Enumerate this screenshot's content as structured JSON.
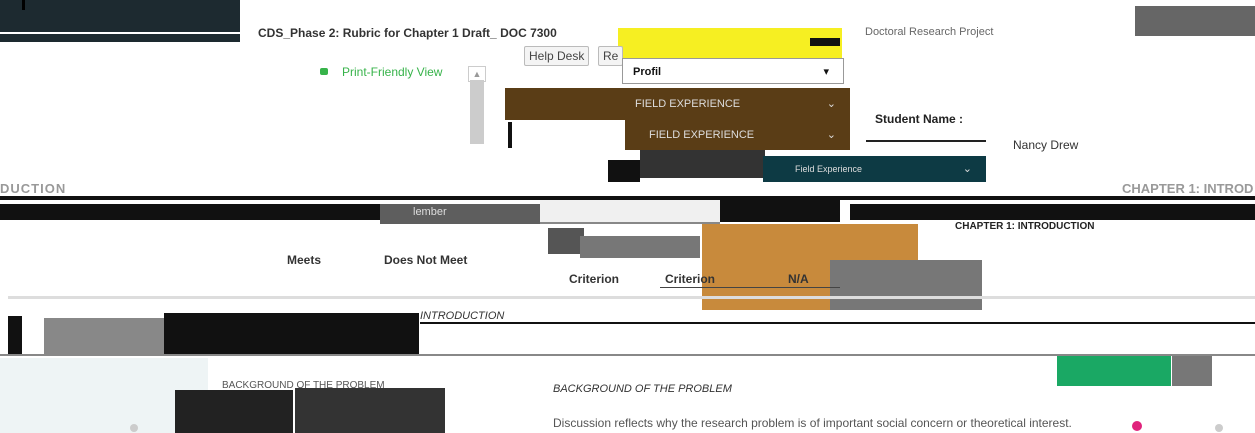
{
  "rubric_title": "CDS_Phase 2: Rubric for Chapter 1 Draft_ DOC 7300",
  "header_right_text": "Doctoral Research Project",
  "print_view_label": "Print-Friendly View",
  "help_desk_label": "Help Desk",
  "second_button_label": "Re",
  "profile_label": "Profil",
  "field_experience_1": "FIELD EXPERIENCE",
  "field_experience_2": "FIELD EXPERIENCE",
  "field_experience_3": "Field Experience",
  "student_name_label": "Student Name :",
  "student_name_value": "Nancy Drew",
  "section_left": "DUCTION",
  "section_right": "CHAPTER 1: INTROD",
  "chapter_heading": "CHAPTER 1: INTRODUCTION",
  "member_label": "lember",
  "col_meets": "Meets",
  "col_does_not_top": "Does Not Meet",
  "col_meets_criterion": "Criterion",
  "col_does_not_criterion": "Criterion",
  "col_na": "N/A",
  "row1_title": "INTRODUCTION",
  "row2_left": "BACKGROUND OF THE PROBLEM",
  "row2_title": "BACKGROUND OF THE PROBLEM",
  "row2_desc": "Discussion reflects why the research problem is of important social concern or theoretical interest."
}
